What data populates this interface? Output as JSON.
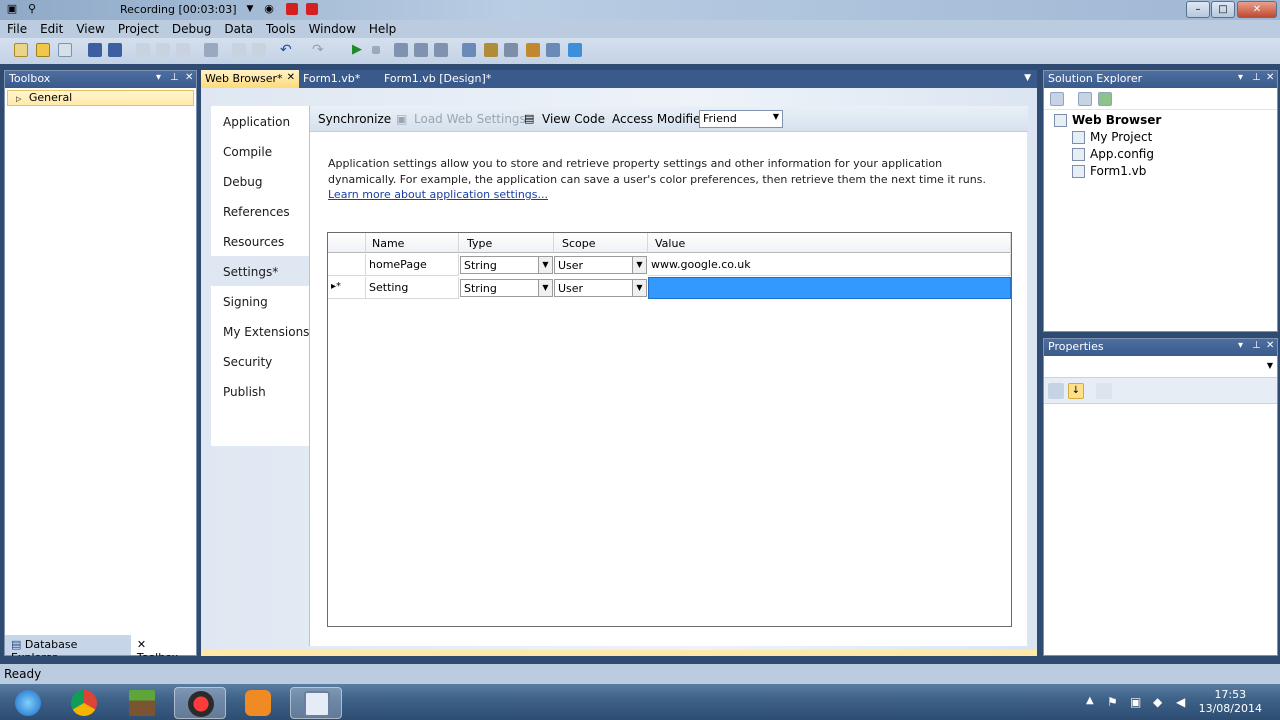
{
  "recording": {
    "label": "Recording [00:03:03]"
  },
  "menu": [
    "File",
    "Edit",
    "View",
    "Project",
    "Debug",
    "Data",
    "Tools",
    "Window",
    "Help"
  ],
  "toolbox": {
    "title": "Toolbox",
    "group": "General",
    "bottom_tabs": [
      "Database Explorer",
      "Toolbox"
    ]
  },
  "doc_tabs": [
    "Web Browser*",
    "Form1.vb*",
    "Form1.vb [Design]*"
  ],
  "project_nav": [
    "Application",
    "Compile",
    "Debug",
    "References",
    "Resources",
    "Settings*",
    "Signing",
    "My Extensions",
    "Security",
    "Publish"
  ],
  "settings_toolbar": {
    "synchronize": "Synchronize",
    "load_web_settings": "Load Web Settings",
    "view_code": "View Code",
    "access_modifier_label": "Access Modifier:",
    "access_modifier_value": "Friend"
  },
  "description": {
    "text": "Application settings allow you to store and retrieve property settings and other information for your application dynamically. For example, the application can save a user's color preferences, then retrieve them the next time it runs.",
    "link": "Learn more about application settings..."
  },
  "grid": {
    "columns": [
      "Name",
      "Type",
      "Scope",
      "Value"
    ],
    "rows": [
      {
        "indicator": "",
        "name": "homePage",
        "type": "String",
        "scope": "User",
        "value": "www.google.co.uk"
      },
      {
        "indicator": "▸*",
        "name": "Setting",
        "type": "String",
        "scope": "User",
        "value": ""
      }
    ]
  },
  "solution_explorer": {
    "title": "Solution Explorer",
    "project": "Web Browser",
    "items": [
      "My Project",
      "App.config",
      "Form1.vb"
    ]
  },
  "properties": {
    "title": "Properties"
  },
  "status": "Ready",
  "clock": {
    "time": "17:53",
    "date": "13/08/2014"
  },
  "colors": {
    "accent": "#3399ff",
    "chrome": "#bccce0",
    "tab_active": "#ffd97a"
  }
}
